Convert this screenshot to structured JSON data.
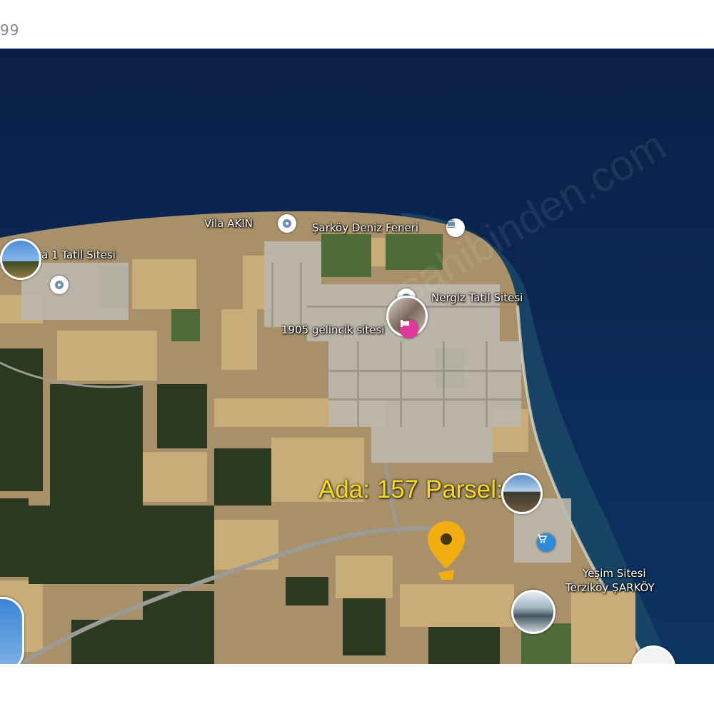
{
  "header": {
    "cropped_text": "99"
  },
  "map": {
    "parcel_label": "Ada: 157  Parsel: 4",
    "places": [
      {
        "id": "vila_akin",
        "name": "Vila AKIN"
      },
      {
        "id": "deniz_feneri",
        "name": "Şarköy Deniz Feneri"
      },
      {
        "id": "tatil_sitesi",
        "name": "a 1 Tatil Sitesi"
      },
      {
        "id": "nergiz",
        "name": "Nergiz Tatil Sitesi"
      },
      {
        "id": "gelincik",
        "name": "1905 gelincik sitesi"
      },
      {
        "id": "yesim_line1",
        "name": "Yeşim Sitesi"
      },
      {
        "id": "yesim_line2",
        "name": "Terziköy ŞARKÖY"
      }
    ],
    "colors": {
      "sea": "#0b2a57",
      "shallow_sea": "#1f4f6e",
      "land": "#b59c6e",
      "fields": "#c9ad78",
      "vegetation": "#2d3d22",
      "parcel_marker": "#f2ad11",
      "lodging_pin": "#e0399b",
      "shop_pin": "#2e8bd8"
    },
    "icons": [
      "place-pin-icon",
      "parcel-marker-icon",
      "lodging-icon",
      "shopping-cart-icon",
      "museum-icon"
    ]
  }
}
